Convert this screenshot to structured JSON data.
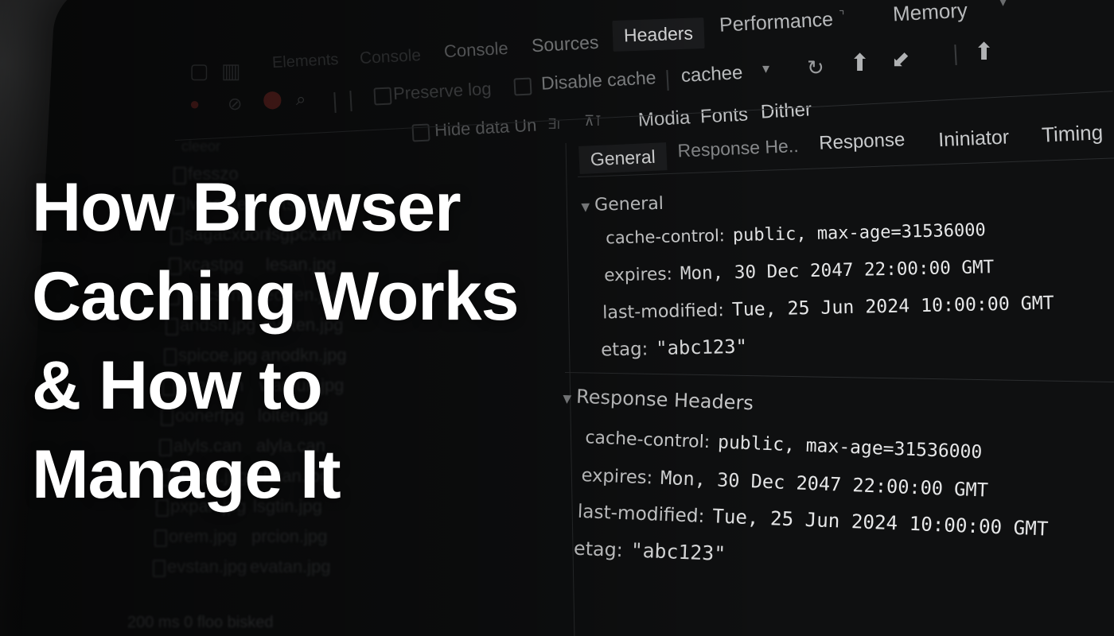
{
  "devtools": {
    "main_tabs": [
      "Elements",
      "Console",
      "Console",
      "Sources",
      "Headers",
      "Performance",
      "Memory"
    ],
    "toolbar": {
      "preserve_log": "Preserve log",
      "disable_cache": "Disable cache",
      "throttle": "cachee"
    },
    "filter_row": {
      "hide_data": "Hide data Un",
      "types": [
        "Modia",
        "Fonts",
        "Dither"
      ]
    },
    "file_list": [
      {
        "name": "fesszo",
        "type": ""
      },
      {
        "name": "lwhenten",
        "type": "wtsoooo"
      },
      {
        "name": "sagacxoon",
        "type": "lsgpcx.an"
      },
      {
        "name": "xcastpg",
        "type": "lesan.jpg"
      },
      {
        "name": "xsrcscn",
        "type": "eotren.jpg"
      },
      {
        "name": "andsn.jpg",
        "type": "avoten.jpg"
      },
      {
        "name": "spicoe.jpg",
        "type": "anodkn.jpg"
      },
      {
        "name": "dbeusen",
        "type": "wamun.jpg"
      },
      {
        "name": "oonerfpg",
        "type": "lolten.jpg"
      },
      {
        "name": "alyls.can",
        "type": "alyla.can"
      },
      {
        "name": "sngpa.jpg",
        "type": "clutan.jpg"
      },
      {
        "name": "pxpan.jpg",
        "type": "lsgtin.jpg"
      },
      {
        "name": "orem.jpg",
        "type": "prcion.jpg"
      },
      {
        "name": "evstan.jpg",
        "type": "evatan.jpg"
      }
    ],
    "status_bar": "200 ms   0 floo bisked",
    "detail_tabs": [
      "General",
      "Response He..",
      "Response",
      "Ininiator",
      "Timing"
    ],
    "general": {
      "title": "General",
      "rows": [
        {
          "key": "cache-control:",
          "value": "public, max-age=31536000"
        },
        {
          "key": "expires:",
          "value": "Mon, 30 Dec 2047 22:00:00 GMT"
        },
        {
          "key": "last-modified:",
          "value": "Tue, 25 Jun 2024 10:00:00 GMT"
        },
        {
          "key": "etag:",
          "value": "\"abc123\""
        }
      ]
    },
    "response_headers": {
      "title": "Response Headers",
      "rows": [
        {
          "key": "cache-control:",
          "value": "public, max-age=31536000"
        },
        {
          "key": "expires:",
          "value": "Mon, 30 Dec 2047 22:00:00 GMT"
        },
        {
          "key": "last-modified:",
          "value": "Tue, 25 Jun 2024 10:00:00 GMT"
        },
        {
          "key": "etag:",
          "value": "\"abc123\""
        }
      ]
    }
  },
  "headline": {
    "line1": "How Browser",
    "line2": "Caching Works",
    "line3": "& How to",
    "line4": "Manage It"
  },
  "icons": [
    "record-icon",
    "stop-icon",
    "search-icon",
    "filter-icon",
    "upload-icon",
    "refresh-icon",
    "download-icon"
  ]
}
